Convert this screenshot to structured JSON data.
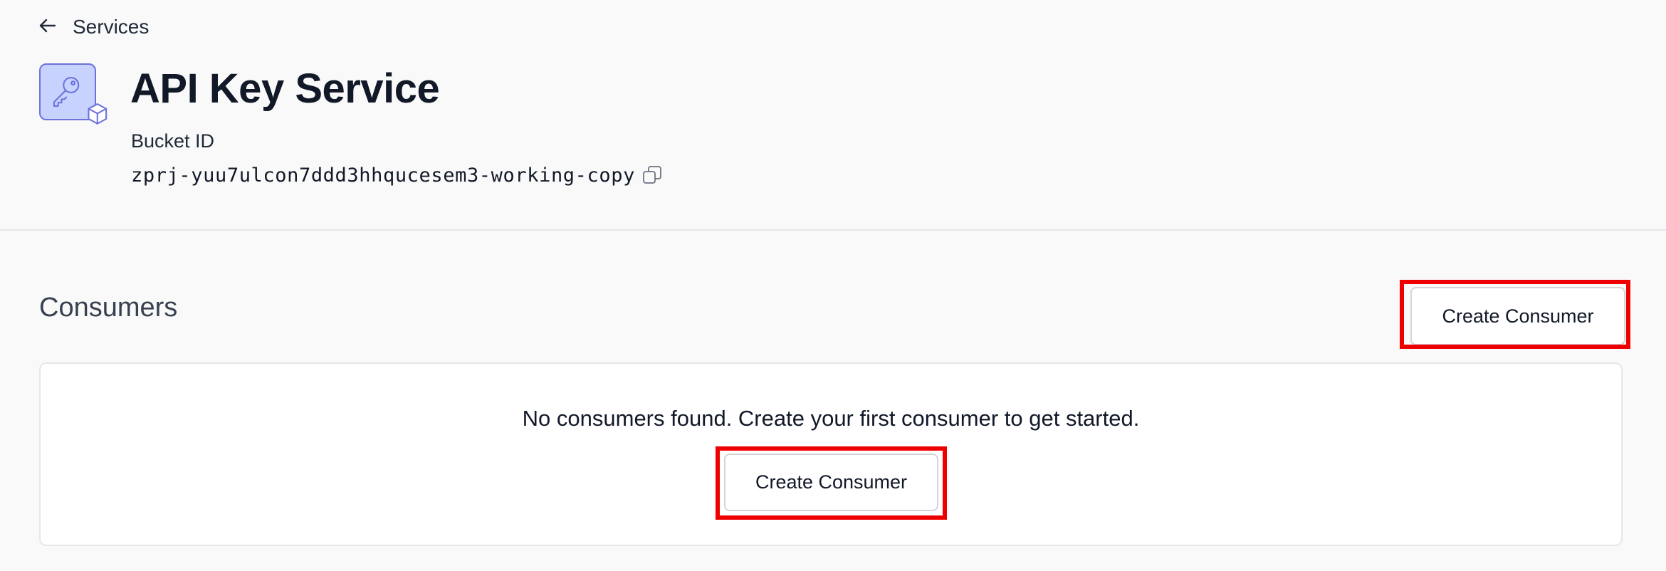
{
  "navigation": {
    "back_label": "Services",
    "back_icon": "arrow-left-icon"
  },
  "service": {
    "title": "API Key Service",
    "icon": "key-box-icon",
    "bucket_label": "Bucket ID",
    "bucket_id": "zprj-yuu7ulcon7ddd3hhqucesem3-working-copy",
    "copy_icon": "copy-icon"
  },
  "consumers": {
    "section_title": "Consumers",
    "create_button_label": "Create Consumer",
    "empty_message": "No consumers found. Create your first consumer to get started.",
    "empty_create_button_label": "Create Consumer"
  },
  "colors": {
    "background": "#f9f9f9",
    "icon_fill": "#c7d2fe",
    "icon_stroke": "#6d73dc",
    "highlight": "#ee0000"
  }
}
